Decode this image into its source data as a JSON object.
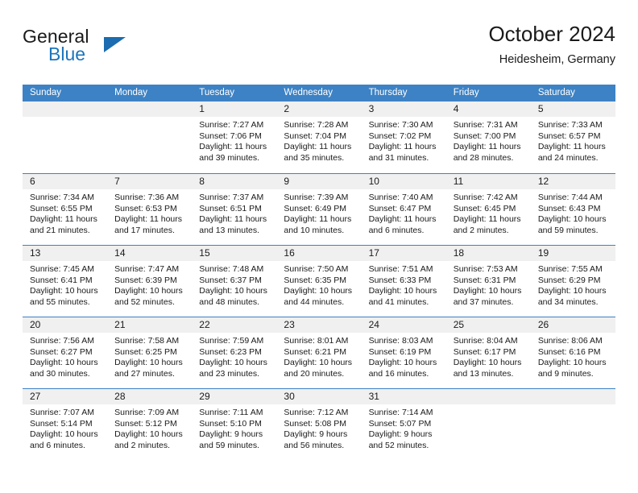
{
  "brand": {
    "word_general": "General",
    "word_blue": "Blue",
    "triangle_icon": "brand-triangle-icon",
    "accent_color": "#1b75bb"
  },
  "header": {
    "title": "October 2024",
    "subtitle": "Heidesheim, Germany"
  },
  "theme": {
    "header_bar": "#3d82c4",
    "day_number_bg": "#f0f0f0",
    "text": "#1a1a1a"
  },
  "weekdays": [
    "Sunday",
    "Monday",
    "Tuesday",
    "Wednesday",
    "Thursday",
    "Friday",
    "Saturday"
  ],
  "labels": {
    "sunrise_prefix": "Sunrise:",
    "sunset_prefix": "Sunset:",
    "daylight_prefix": "Daylight:"
  },
  "weeks": [
    [
      {
        "day": "",
        "sunrise": "",
        "sunset": "",
        "daylight": ""
      },
      {
        "day": "",
        "sunrise": "",
        "sunset": "",
        "daylight": ""
      },
      {
        "day": "1",
        "sunrise": "Sunrise: 7:27 AM",
        "sunset": "Sunset: 7:06 PM",
        "daylight": "Daylight: 11 hours and 39 minutes."
      },
      {
        "day": "2",
        "sunrise": "Sunrise: 7:28 AM",
        "sunset": "Sunset: 7:04 PM",
        "daylight": "Daylight: 11 hours and 35 minutes."
      },
      {
        "day": "3",
        "sunrise": "Sunrise: 7:30 AM",
        "sunset": "Sunset: 7:02 PM",
        "daylight": "Daylight: 11 hours and 31 minutes."
      },
      {
        "day": "4",
        "sunrise": "Sunrise: 7:31 AM",
        "sunset": "Sunset: 7:00 PM",
        "daylight": "Daylight: 11 hours and 28 minutes."
      },
      {
        "day": "5",
        "sunrise": "Sunrise: 7:33 AM",
        "sunset": "Sunset: 6:57 PM",
        "daylight": "Daylight: 11 hours and 24 minutes."
      }
    ],
    [
      {
        "day": "6",
        "sunrise": "Sunrise: 7:34 AM",
        "sunset": "Sunset: 6:55 PM",
        "daylight": "Daylight: 11 hours and 21 minutes."
      },
      {
        "day": "7",
        "sunrise": "Sunrise: 7:36 AM",
        "sunset": "Sunset: 6:53 PM",
        "daylight": "Daylight: 11 hours and 17 minutes."
      },
      {
        "day": "8",
        "sunrise": "Sunrise: 7:37 AM",
        "sunset": "Sunset: 6:51 PM",
        "daylight": "Daylight: 11 hours and 13 minutes."
      },
      {
        "day": "9",
        "sunrise": "Sunrise: 7:39 AM",
        "sunset": "Sunset: 6:49 PM",
        "daylight": "Daylight: 11 hours and 10 minutes."
      },
      {
        "day": "10",
        "sunrise": "Sunrise: 7:40 AM",
        "sunset": "Sunset: 6:47 PM",
        "daylight": "Daylight: 11 hours and 6 minutes."
      },
      {
        "day": "11",
        "sunrise": "Sunrise: 7:42 AM",
        "sunset": "Sunset: 6:45 PM",
        "daylight": "Daylight: 11 hours and 2 minutes."
      },
      {
        "day": "12",
        "sunrise": "Sunrise: 7:44 AM",
        "sunset": "Sunset: 6:43 PM",
        "daylight": "Daylight: 10 hours and 59 minutes."
      }
    ],
    [
      {
        "day": "13",
        "sunrise": "Sunrise: 7:45 AM",
        "sunset": "Sunset: 6:41 PM",
        "daylight": "Daylight: 10 hours and 55 minutes."
      },
      {
        "day": "14",
        "sunrise": "Sunrise: 7:47 AM",
        "sunset": "Sunset: 6:39 PM",
        "daylight": "Daylight: 10 hours and 52 minutes."
      },
      {
        "day": "15",
        "sunrise": "Sunrise: 7:48 AM",
        "sunset": "Sunset: 6:37 PM",
        "daylight": "Daylight: 10 hours and 48 minutes."
      },
      {
        "day": "16",
        "sunrise": "Sunrise: 7:50 AM",
        "sunset": "Sunset: 6:35 PM",
        "daylight": "Daylight: 10 hours and 44 minutes."
      },
      {
        "day": "17",
        "sunrise": "Sunrise: 7:51 AM",
        "sunset": "Sunset: 6:33 PM",
        "daylight": "Daylight: 10 hours and 41 minutes."
      },
      {
        "day": "18",
        "sunrise": "Sunrise: 7:53 AM",
        "sunset": "Sunset: 6:31 PM",
        "daylight": "Daylight: 10 hours and 37 minutes."
      },
      {
        "day": "19",
        "sunrise": "Sunrise: 7:55 AM",
        "sunset": "Sunset: 6:29 PM",
        "daylight": "Daylight: 10 hours and 34 minutes."
      }
    ],
    [
      {
        "day": "20",
        "sunrise": "Sunrise: 7:56 AM",
        "sunset": "Sunset: 6:27 PM",
        "daylight": "Daylight: 10 hours and 30 minutes."
      },
      {
        "day": "21",
        "sunrise": "Sunrise: 7:58 AM",
        "sunset": "Sunset: 6:25 PM",
        "daylight": "Daylight: 10 hours and 27 minutes."
      },
      {
        "day": "22",
        "sunrise": "Sunrise: 7:59 AM",
        "sunset": "Sunset: 6:23 PM",
        "daylight": "Daylight: 10 hours and 23 minutes."
      },
      {
        "day": "23",
        "sunrise": "Sunrise: 8:01 AM",
        "sunset": "Sunset: 6:21 PM",
        "daylight": "Daylight: 10 hours and 20 minutes."
      },
      {
        "day": "24",
        "sunrise": "Sunrise: 8:03 AM",
        "sunset": "Sunset: 6:19 PM",
        "daylight": "Daylight: 10 hours and 16 minutes."
      },
      {
        "day": "25",
        "sunrise": "Sunrise: 8:04 AM",
        "sunset": "Sunset: 6:17 PM",
        "daylight": "Daylight: 10 hours and 13 minutes."
      },
      {
        "day": "26",
        "sunrise": "Sunrise: 8:06 AM",
        "sunset": "Sunset: 6:16 PM",
        "daylight": "Daylight: 10 hours and 9 minutes."
      }
    ],
    [
      {
        "day": "27",
        "sunrise": "Sunrise: 7:07 AM",
        "sunset": "Sunset: 5:14 PM",
        "daylight": "Daylight: 10 hours and 6 minutes."
      },
      {
        "day": "28",
        "sunrise": "Sunrise: 7:09 AM",
        "sunset": "Sunset: 5:12 PM",
        "daylight": "Daylight: 10 hours and 2 minutes."
      },
      {
        "day": "29",
        "sunrise": "Sunrise: 7:11 AM",
        "sunset": "Sunset: 5:10 PM",
        "daylight": "Daylight: 9 hours and 59 minutes."
      },
      {
        "day": "30",
        "sunrise": "Sunrise: 7:12 AM",
        "sunset": "Sunset: 5:08 PM",
        "daylight": "Daylight: 9 hours and 56 minutes."
      },
      {
        "day": "31",
        "sunrise": "Sunrise: 7:14 AM",
        "sunset": "Sunset: 5:07 PM",
        "daylight": "Daylight: 9 hours and 52 minutes."
      },
      {
        "day": "",
        "sunrise": "",
        "sunset": "",
        "daylight": ""
      },
      {
        "day": "",
        "sunrise": "",
        "sunset": "",
        "daylight": ""
      }
    ]
  ]
}
